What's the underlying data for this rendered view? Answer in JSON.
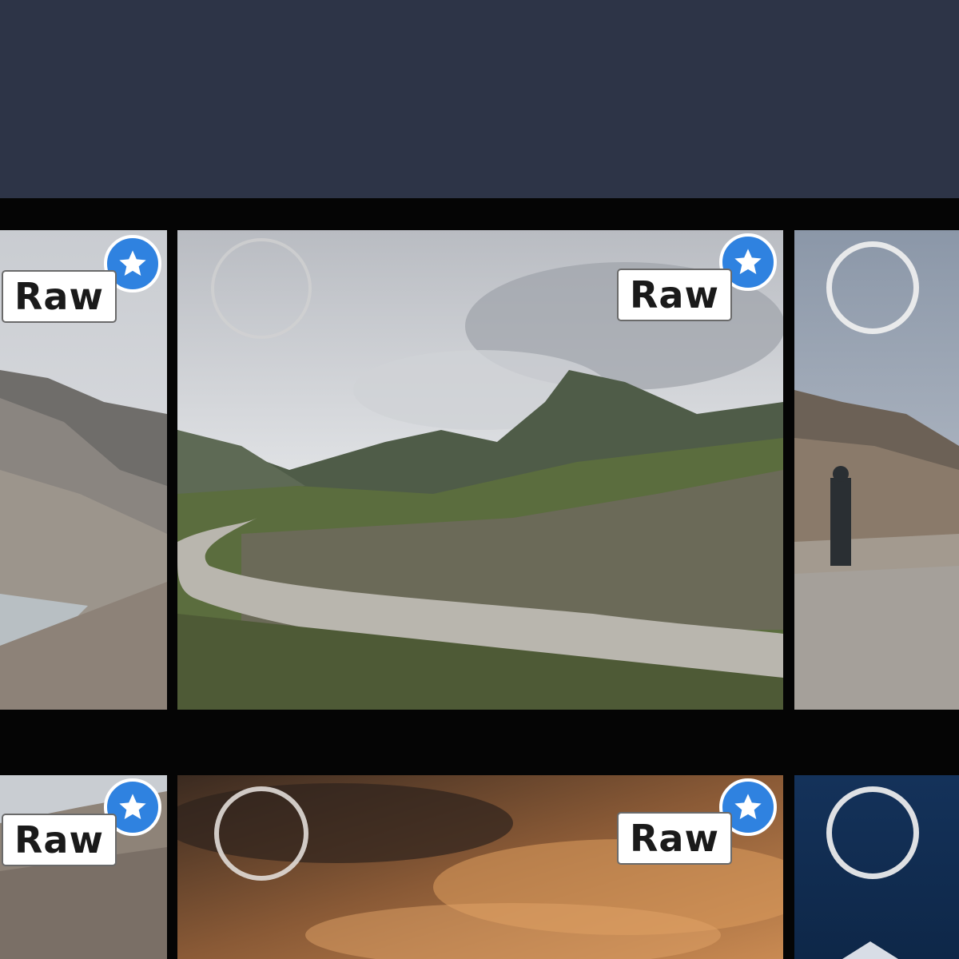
{
  "header": {
    "background_color": "#2d3447"
  },
  "grid": {
    "rows": [
      {
        "tiles": [
          {
            "photo": "mountain-valley-river",
            "raw_label": "Raw",
            "favorite": true,
            "selected": false
          },
          {
            "photo": "cloudy-mountain-river-valley",
            "raw_label": "Raw",
            "favorite": true,
            "selected": false
          },
          {
            "photo": "shepherd-with-sheep-mountain",
            "favorite": false,
            "selected": false
          }
        ]
      },
      {
        "tiles": [
          {
            "photo": "rocky-mountain-slope",
            "raw_label": "Raw",
            "favorite": true,
            "selected": false
          },
          {
            "photo": "orange-sunset-clouds",
            "raw_label": "Raw",
            "favorite": true,
            "selected": false
          },
          {
            "photo": "night-blue-sky",
            "favorite": false,
            "selected": false
          }
        ]
      }
    ]
  },
  "icons": {
    "favorite": "star-icon",
    "select": "selection-circle-icon"
  },
  "colors": {
    "favorite_badge": "#2f82e0",
    "raw_badge_background": "#ffffff",
    "raw_badge_text": "#1a1a1a"
  }
}
